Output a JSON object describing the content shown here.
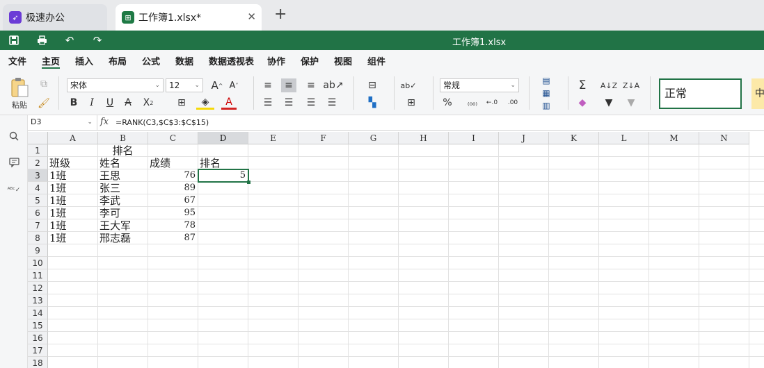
{
  "tabs": [
    {
      "label": "极速办公"
    },
    {
      "label": "工作簿1.xlsx*"
    }
  ],
  "title_bar": {
    "title": "工作簿1.xlsx"
  },
  "menu": [
    "文件",
    "主页",
    "插入",
    "布局",
    "公式",
    "数据",
    "数据透视表",
    "协作",
    "保护",
    "视图",
    "组件"
  ],
  "ribbon": {
    "paste_label": "粘贴",
    "font_name": "宋体",
    "font_size": "12",
    "number_format": "常规",
    "cell_style_normal": "正常",
    "cell_style_next": "中"
  },
  "formula_bar": {
    "cell_ref": "D3",
    "fx": "fx",
    "formula": "=RANK(C3,$C$3:$C$15)"
  },
  "columns": [
    "A",
    "B",
    "C",
    "D",
    "E",
    "F",
    "G",
    "H",
    "I",
    "J",
    "K",
    "L",
    "M",
    "N"
  ],
  "rows": [
    "1",
    "2",
    "3",
    "4",
    "5",
    "6",
    "7",
    "8",
    "9",
    "10",
    "11",
    "12",
    "13",
    "14",
    "15",
    "16",
    "17",
    "18"
  ],
  "sheet": {
    "title": "排名",
    "headers": [
      "班级",
      "姓名",
      "成绩",
      "排名"
    ],
    "data": [
      [
        "1班",
        "王思",
        "76",
        "5"
      ],
      [
        "1班",
        "张三",
        "89",
        ""
      ],
      [
        "1班",
        "李武",
        "67",
        ""
      ],
      [
        "1班",
        "李可",
        "95",
        ""
      ],
      [
        "1班",
        "王大军",
        "78",
        ""
      ],
      [
        "1班",
        "邢志磊",
        "87",
        ""
      ]
    ]
  },
  "colors": {
    "accent": "#217346"
  }
}
